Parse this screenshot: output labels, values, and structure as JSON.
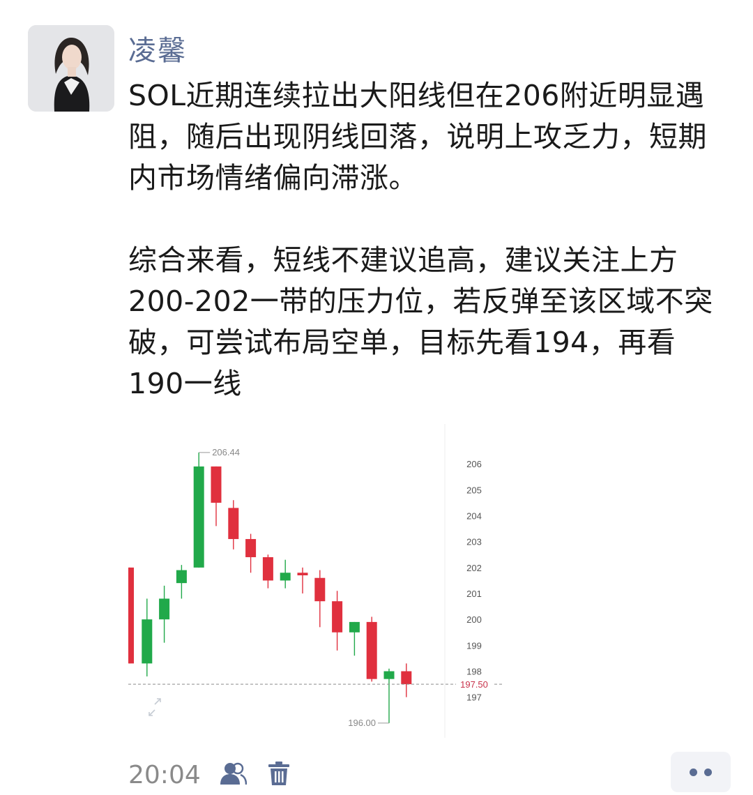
{
  "post": {
    "author": "凌馨",
    "paragraph1": "SOL近期连续拉出大阳线但在206附近明显遇阻，随后出现阴线回落，说明上攻乏力，短期内市场情绪偏向滞涨。",
    "paragraph2": "综合来看，短线不建议追高，建议关注上方200-202一带的压力位，若反弹至该区域不突破，可尝试布局空单，目标先看194，再看190一线",
    "time": "20:04"
  },
  "icons": {
    "avatar": "avatar-photo",
    "visibility": "friends-icon",
    "delete": "trash-icon",
    "more": "more-dots-icon",
    "expand": "expand-icon"
  },
  "colors": {
    "up": "#21a94a",
    "down": "#e0303e",
    "current": "#c8324a",
    "name": "#5a6c93"
  },
  "chart_data": {
    "type": "candlestick",
    "title": "",
    "y_ticks": [
      "206",
      "205",
      "204",
      "203",
      "202",
      "201",
      "200",
      "199",
      "198",
      "197"
    ],
    "ylim": [
      195.7,
      207.0
    ],
    "candles": [
      {
        "open": 202.0,
        "high": 202.0,
        "low": 198.3,
        "close": 198.3
      },
      {
        "open": 198.3,
        "high": 200.8,
        "low": 197.8,
        "close": 200.0
      },
      {
        "open": 200.0,
        "high": 201.3,
        "low": 199.1,
        "close": 200.8
      },
      {
        "open": 201.4,
        "high": 202.1,
        "low": 200.8,
        "close": 201.9
      },
      {
        "open": 202.0,
        "high": 206.44,
        "low": 202.0,
        "close": 205.9
      },
      {
        "open": 205.9,
        "high": 205.9,
        "low": 203.6,
        "close": 204.5
      },
      {
        "open": 204.3,
        "high": 204.6,
        "low": 202.7,
        "close": 203.1
      },
      {
        "open": 203.1,
        "high": 203.3,
        "low": 201.8,
        "close": 202.4
      },
      {
        "open": 202.4,
        "high": 202.5,
        "low": 201.2,
        "close": 201.5
      },
      {
        "open": 201.5,
        "high": 202.3,
        "low": 201.2,
        "close": 201.8
      },
      {
        "open": 201.8,
        "high": 202.0,
        "low": 201.0,
        "close": 201.7
      },
      {
        "open": 201.6,
        "high": 201.9,
        "low": 199.7,
        "close": 200.7
      },
      {
        "open": 200.7,
        "high": 201.1,
        "low": 198.8,
        "close": 199.5
      },
      {
        "open": 199.5,
        "high": 199.9,
        "low": 198.6,
        "close": 199.9
      },
      {
        "open": 199.9,
        "high": 200.1,
        "low": 197.6,
        "close": 197.7
      },
      {
        "open": 197.7,
        "high": 198.1,
        "low": 196.0,
        "close": 198.0
      },
      {
        "open": 198.0,
        "high": 198.3,
        "low": 197.0,
        "close": 197.5
      }
    ],
    "high_label": "206.44",
    "low_label": "196.00",
    "current_price": 197.5,
    "current_label": "197.50"
  }
}
